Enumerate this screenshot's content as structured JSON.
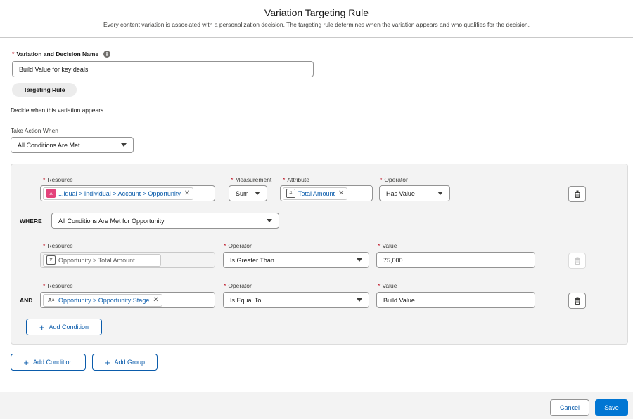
{
  "header": {
    "title": "Variation Targeting Rule",
    "subtitle": "Every content variation is associated with a personalization decision. The targeting rule determines when the variation appears and who qualifies for the decision."
  },
  "name_field": {
    "required_mark": "*",
    "label": "Variation and Decision Name",
    "info_icon": "info-icon",
    "value": "Build Value for key deals"
  },
  "targeting_rule_tab": "Targeting Rule",
  "description": "Decide when this variation appears.",
  "take_action": {
    "label": "Take Action When",
    "value": "All Conditions Are Met"
  },
  "main_condition": {
    "resource_label": "Resource",
    "resource_value": "...idual > Individual > Account > Opportunity",
    "resource_icon": "object-icon",
    "measurement_label": "Measurement",
    "measurement_value": "Sum",
    "attribute_label": "Attribute",
    "attribute_value": "Total Amount",
    "attribute_icon": "number-icon",
    "operator_label": "Operator",
    "operator_value": "Has Value"
  },
  "where": {
    "label": "WHERE",
    "value": "All Conditions Are Met for Opportunity"
  },
  "sub_conditions": [
    {
      "prefix": "",
      "resource_label": "Resource",
      "resource_value": "Opportunity > Total Amount",
      "resource_icon": "number-icon",
      "operator_label": "Operator",
      "operator_value": "Is Greater Than",
      "value_label": "Value",
      "value": "75,000"
    },
    {
      "prefix": "AND",
      "resource_label": "Resource",
      "resource_value": "Opportunity > Opportunity Stage",
      "resource_icon": "text-icon",
      "operator_label": "Operator",
      "operator_value": "Is Equal To",
      "value_label": "Value",
      "value": "Build Value"
    }
  ],
  "inner_add_condition": "Add Condition",
  "outer_add_condition": "Add Condition",
  "outer_add_group": "Add Group",
  "footer": {
    "cancel": "Cancel",
    "save": "Save"
  },
  "colors": {
    "brand": "#0176d3",
    "link": "#0b5cab",
    "required": "#ba0517",
    "resource_icon": "#e3427b"
  }
}
